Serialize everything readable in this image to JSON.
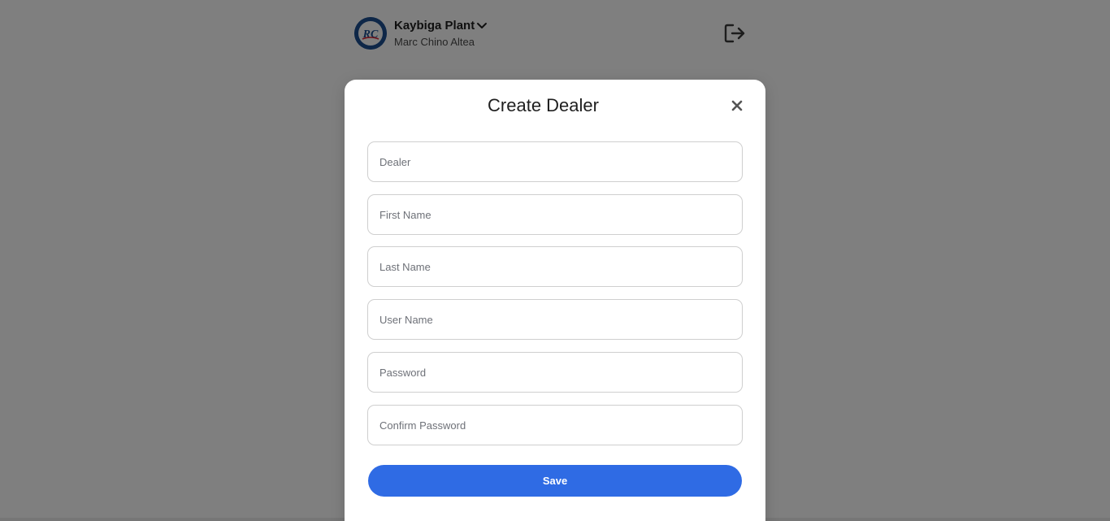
{
  "header": {
    "org_name": "Kaybiga Plant",
    "user_name": "Marc Chino Altea",
    "avatar_initials": "RC",
    "avatar_icon": "company-logo",
    "dropdown_icon": "chevron-down-icon",
    "logout_icon": "logout-icon"
  },
  "modal": {
    "title": "Create Dealer",
    "close_icon": "close-icon",
    "fields": [
      {
        "placeholder": "Dealer",
        "value": ""
      },
      {
        "placeholder": "First Name",
        "value": ""
      },
      {
        "placeholder": "Last Name",
        "value": ""
      },
      {
        "placeholder": "User Name",
        "value": ""
      },
      {
        "placeholder": "Password",
        "value": ""
      },
      {
        "placeholder": "Confirm Password",
        "value": ""
      }
    ],
    "save_label": "Save"
  },
  "colors": {
    "accent": "#2f6be4",
    "overlay": "rgba(0,0,0,0.5)",
    "avatar_bg": "#1d4f91"
  }
}
